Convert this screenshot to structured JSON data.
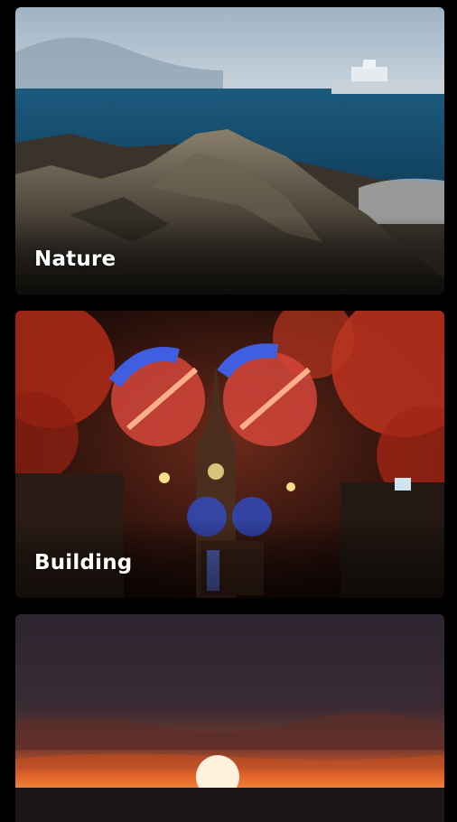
{
  "categories": [
    {
      "label": "Nature",
      "icon": "rocky-coast-photo"
    },
    {
      "label": "Building",
      "icon": "illuminated-cathedral-photo"
    },
    {
      "label": "",
      "icon": "ocean-sunset-photo"
    }
  ],
  "colors": {
    "background": "#000000",
    "label_text": "#ffffff",
    "sea": "#1c5a7e",
    "autumn_red": "#c0321e",
    "sunset_orange": "#e4642a"
  }
}
